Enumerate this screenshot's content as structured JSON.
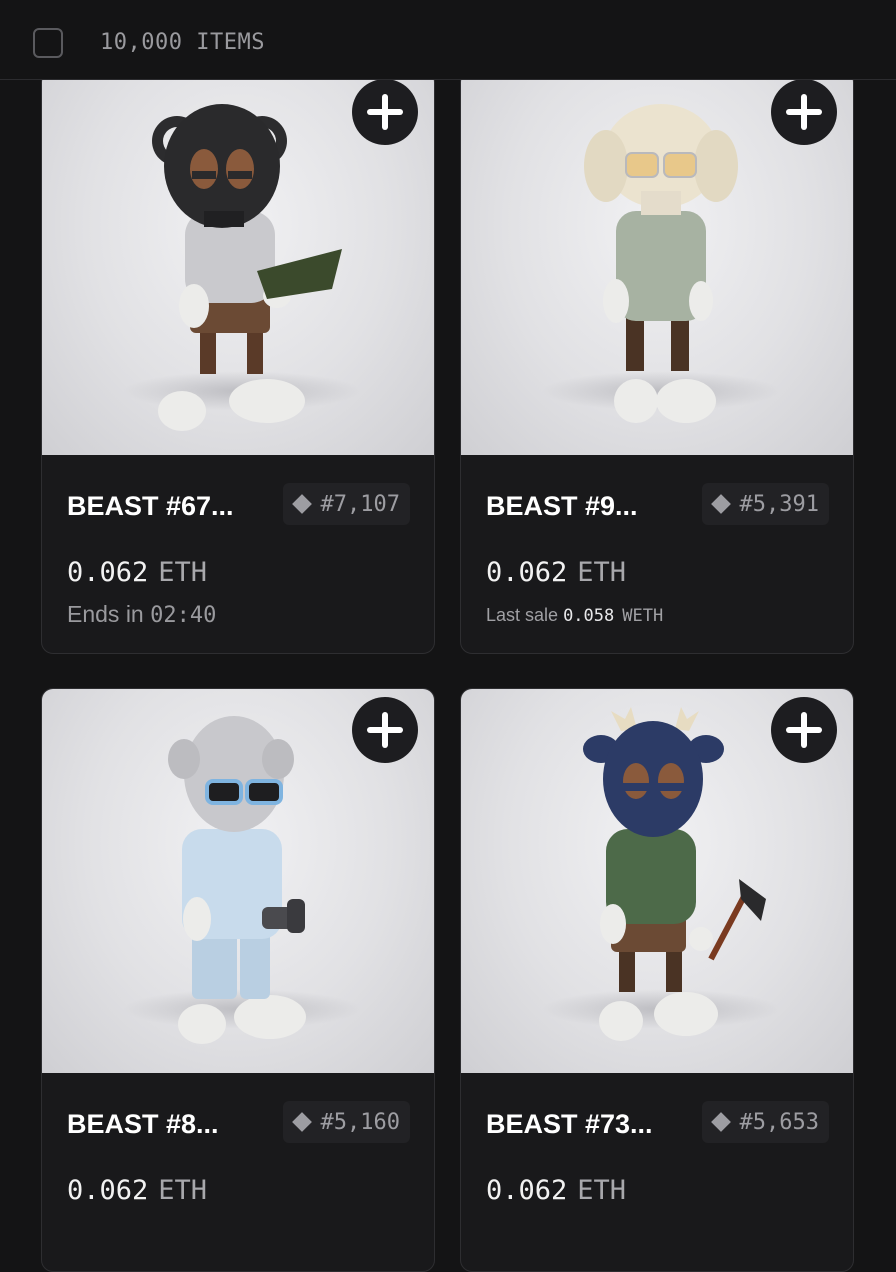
{
  "header": {
    "items_count": "10,000 ITEMS"
  },
  "cards": [
    {
      "title": "BEAST #67...",
      "rank": "#7,107",
      "price": "0.062",
      "currency": "ETH",
      "ends_label": "Ends in",
      "ends_time": "02:40"
    },
    {
      "title": "BEAST #9...",
      "rank": "#5,391",
      "price": "0.062",
      "currency": "ETH",
      "last_sale_label": "Last sale",
      "last_sale_value": "0.058",
      "last_sale_currency": "WETH"
    },
    {
      "title": "BEAST #8...",
      "rank": "#5,160",
      "price": "0.062",
      "currency": "ETH"
    },
    {
      "title": "BEAST #73...",
      "rank": "#5,653",
      "price": "0.062",
      "currency": "ETH"
    }
  ]
}
